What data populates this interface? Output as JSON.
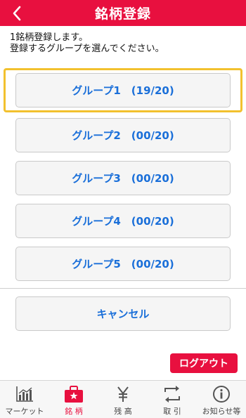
{
  "header": {
    "title": "銘柄登録"
  },
  "instructions": {
    "line1": "1銘柄登録します。",
    "line2": "登録するグループを選んでください。"
  },
  "groups": [
    {
      "label": "グループ1　(19/20)"
    },
    {
      "label": "グループ2　(00/20)"
    },
    {
      "label": "グループ3　(00/20)"
    },
    {
      "label": "グループ4　(00/20)"
    },
    {
      "label": "グループ5　(00/20)"
    }
  ],
  "cancel": {
    "label": "キャンセル"
  },
  "logout": {
    "label": "ログアウト"
  },
  "tabs": [
    {
      "label": "マーケット",
      "icon": "chart-icon"
    },
    {
      "label": "銘 柄",
      "icon": "briefcase-star-icon",
      "active": true
    },
    {
      "label": "残 高",
      "icon": "yen-icon"
    },
    {
      "label": "取 引",
      "icon": "exchange-icon"
    },
    {
      "label": "お知らせ等",
      "icon": "info-icon"
    }
  ],
  "colors": {
    "brand": "#e8103f",
    "link": "#1a6fd9",
    "highlight": "#f2c12e"
  }
}
